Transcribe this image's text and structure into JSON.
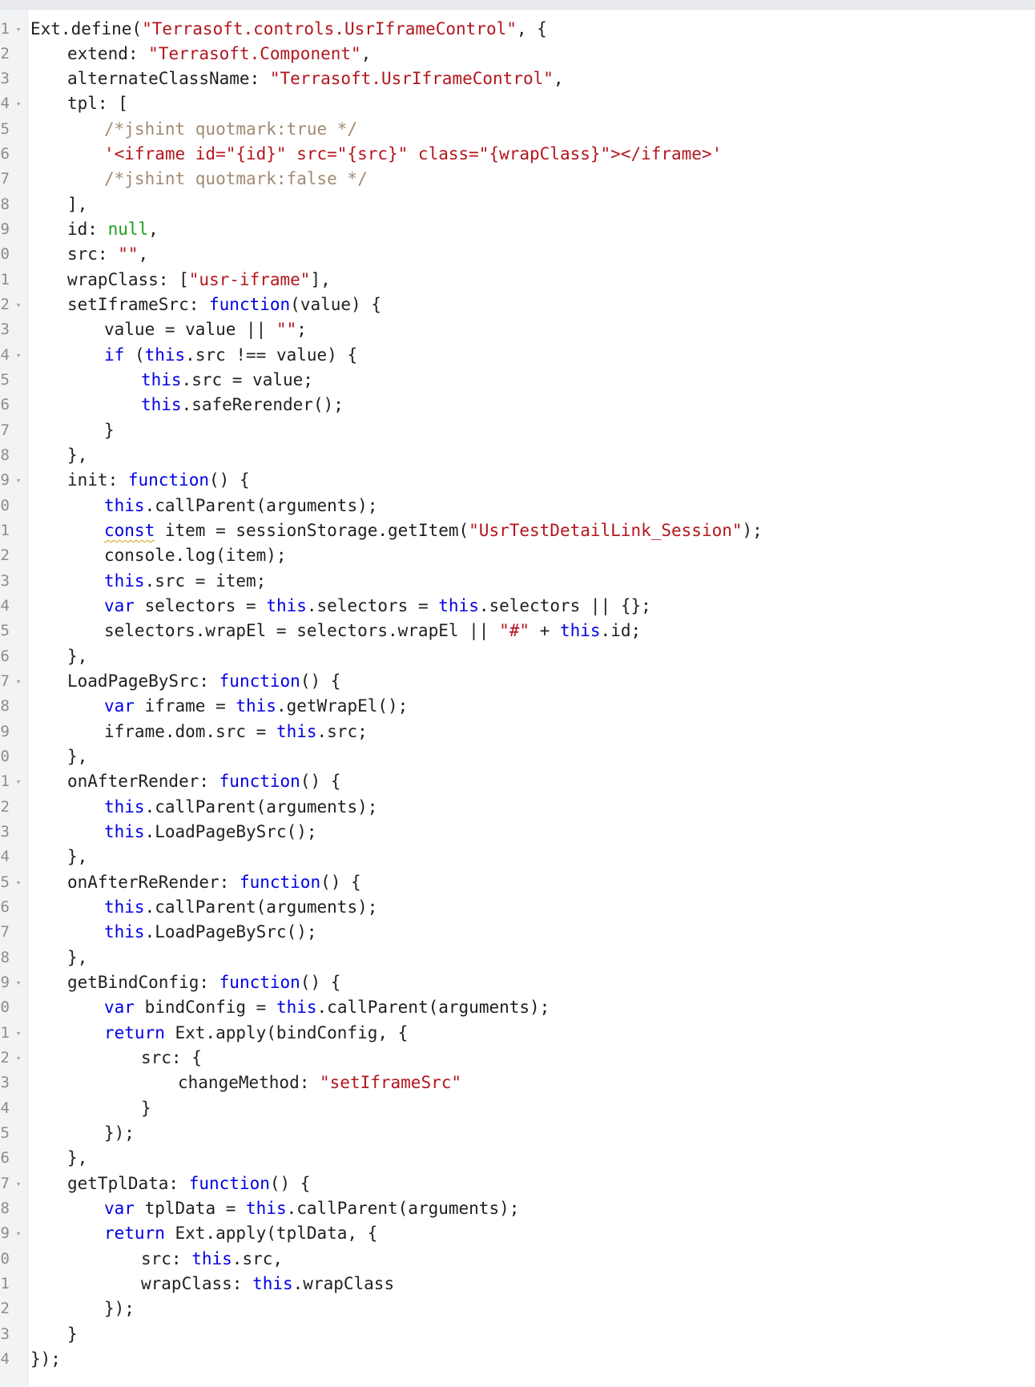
{
  "editor": {
    "lines": [
      {
        "n": "1",
        "fold": true,
        "ind": 0,
        "seg": [
          [
            "pl",
            "Ext.define("
          ],
          [
            "str",
            "\"Terrasoft.controls.UsrIframeControl\""
          ],
          [
            "pl",
            ", {"
          ]
        ]
      },
      {
        "n": "2",
        "fold": false,
        "ind": 1,
        "seg": [
          [
            "pl",
            "extend: "
          ],
          [
            "str",
            "\"Terrasoft.Component\""
          ],
          [
            "pl",
            ","
          ]
        ]
      },
      {
        "n": "3",
        "fold": false,
        "ind": 1,
        "seg": [
          [
            "pl",
            "alternateClassName: "
          ],
          [
            "str",
            "\"Terrasoft.UsrIframeControl\""
          ],
          [
            "pl",
            ","
          ]
        ]
      },
      {
        "n": "4",
        "fold": true,
        "ind": 1,
        "seg": [
          [
            "pl",
            "tpl: ["
          ]
        ]
      },
      {
        "n": "5",
        "fold": false,
        "ind": 2,
        "seg": [
          [
            "cmt",
            "/*jshint quotmark:true */"
          ]
        ]
      },
      {
        "n": "6",
        "fold": false,
        "ind": 2,
        "seg": [
          [
            "str",
            "'<iframe id=\"{id}\" src=\"{src}\" class=\"{wrapClass}\"></iframe>'"
          ]
        ]
      },
      {
        "n": "7",
        "fold": false,
        "ind": 2,
        "seg": [
          [
            "cmt",
            "/*jshint quotmark:false */"
          ]
        ]
      },
      {
        "n": "8",
        "fold": false,
        "ind": 1,
        "seg": [
          [
            "pl",
            "],"
          ]
        ]
      },
      {
        "n": "9",
        "fold": false,
        "ind": 1,
        "seg": [
          [
            "pl",
            "id: "
          ],
          [
            "num",
            "null"
          ],
          [
            "pl",
            ","
          ]
        ]
      },
      {
        "n": "0",
        "fold": false,
        "ind": 1,
        "seg": [
          [
            "pl",
            "src: "
          ],
          [
            "str",
            "\"\""
          ],
          [
            "pl",
            ","
          ]
        ]
      },
      {
        "n": "1",
        "fold": false,
        "ind": 1,
        "seg": [
          [
            "pl",
            "wrapClass: ["
          ],
          [
            "str",
            "\"usr-iframe\""
          ],
          [
            "pl",
            "],"
          ]
        ]
      },
      {
        "n": "2",
        "fold": true,
        "ind": 1,
        "seg": [
          [
            "pl",
            "setIframeSrc: "
          ],
          [
            "kw",
            "function"
          ],
          [
            "pl",
            "(value) {"
          ]
        ]
      },
      {
        "n": "3",
        "fold": false,
        "ind": 2,
        "seg": [
          [
            "pl",
            "value = value || "
          ],
          [
            "str",
            "\"\""
          ],
          [
            "pl",
            ";"
          ]
        ]
      },
      {
        "n": "4",
        "fold": true,
        "ind": 2,
        "seg": [
          [
            "kw",
            "if"
          ],
          [
            "pl",
            " ("
          ],
          [
            "kw",
            "this"
          ],
          [
            "pl",
            ".src !== value) {"
          ]
        ]
      },
      {
        "n": "5",
        "fold": false,
        "ind": 3,
        "seg": [
          [
            "kw",
            "this"
          ],
          [
            "pl",
            ".src = value;"
          ]
        ]
      },
      {
        "n": "6",
        "fold": false,
        "ind": 3,
        "seg": [
          [
            "kw",
            "this"
          ],
          [
            "pl",
            ".safeRerender();"
          ]
        ]
      },
      {
        "n": "7",
        "fold": false,
        "ind": 2,
        "seg": [
          [
            "pl",
            "}"
          ]
        ]
      },
      {
        "n": "8",
        "fold": false,
        "ind": 1,
        "seg": [
          [
            "pl",
            "},"
          ]
        ]
      },
      {
        "n": "9",
        "fold": true,
        "ind": 1,
        "seg": [
          [
            "pl",
            "init: "
          ],
          [
            "kw",
            "function"
          ],
          [
            "pl",
            "() {"
          ]
        ]
      },
      {
        "n": "0",
        "fold": false,
        "ind": 2,
        "seg": [
          [
            "kw",
            "this"
          ],
          [
            "pl",
            ".callParent(arguments);"
          ]
        ]
      },
      {
        "n": "1",
        "fold": false,
        "ind": 2,
        "seg": [
          [
            "kwsq",
            "const"
          ],
          [
            "pl",
            " item = sessionStorage.getItem("
          ],
          [
            "str",
            "\"UsrTestDetailLink_Session\""
          ],
          [
            "pl",
            ");"
          ]
        ]
      },
      {
        "n": "2",
        "fold": false,
        "ind": 2,
        "seg": [
          [
            "pl",
            "console.log(item);"
          ]
        ]
      },
      {
        "n": "3",
        "fold": false,
        "ind": 2,
        "seg": [
          [
            "kw",
            "this"
          ],
          [
            "pl",
            ".src = item;"
          ]
        ]
      },
      {
        "n": "4",
        "fold": false,
        "ind": 2,
        "seg": [
          [
            "kw",
            "var"
          ],
          [
            "pl",
            " selectors = "
          ],
          [
            "kw",
            "this"
          ],
          [
            "pl",
            ".selectors = "
          ],
          [
            "kw",
            "this"
          ],
          [
            "pl",
            ".selectors || {};"
          ]
        ]
      },
      {
        "n": "5",
        "fold": false,
        "ind": 2,
        "seg": [
          [
            "pl",
            "selectors.wrapEl = selectors.wrapEl || "
          ],
          [
            "str",
            "\"#\""
          ],
          [
            "pl",
            " + "
          ],
          [
            "kw",
            "this"
          ],
          [
            "pl",
            ".id;"
          ]
        ]
      },
      {
        "n": "6",
        "fold": false,
        "ind": 1,
        "seg": [
          [
            "pl",
            "},"
          ]
        ]
      },
      {
        "n": "7",
        "fold": true,
        "ind": 1,
        "seg": [
          [
            "pl",
            "LoadPageBySrc: "
          ],
          [
            "kw",
            "function"
          ],
          [
            "pl",
            "() {"
          ]
        ]
      },
      {
        "n": "8",
        "fold": false,
        "ind": 2,
        "seg": [
          [
            "kw",
            "var"
          ],
          [
            "pl",
            " iframe = "
          ],
          [
            "kw",
            "this"
          ],
          [
            "pl",
            ".getWrapEl();"
          ]
        ]
      },
      {
        "n": "9",
        "fold": false,
        "ind": 2,
        "seg": [
          [
            "pl",
            "iframe.dom.src = "
          ],
          [
            "kw",
            "this"
          ],
          [
            "pl",
            ".src;"
          ]
        ]
      },
      {
        "n": "0",
        "fold": false,
        "ind": 1,
        "seg": [
          [
            "pl",
            "},"
          ]
        ]
      },
      {
        "n": "1",
        "fold": true,
        "ind": 1,
        "seg": [
          [
            "pl",
            "onAfterRender: "
          ],
          [
            "kw",
            "function"
          ],
          [
            "pl",
            "() {"
          ]
        ]
      },
      {
        "n": "2",
        "fold": false,
        "ind": 2,
        "seg": [
          [
            "kw",
            "this"
          ],
          [
            "pl",
            ".callParent(arguments);"
          ]
        ]
      },
      {
        "n": "3",
        "fold": false,
        "ind": 2,
        "seg": [
          [
            "kw",
            "this"
          ],
          [
            "pl",
            ".LoadPageBySrc();"
          ]
        ]
      },
      {
        "n": "4",
        "fold": false,
        "ind": 1,
        "seg": [
          [
            "pl",
            "},"
          ]
        ]
      },
      {
        "n": "5",
        "fold": true,
        "ind": 1,
        "seg": [
          [
            "pl",
            "onAfterReRender: "
          ],
          [
            "kw",
            "function"
          ],
          [
            "pl",
            "() {"
          ]
        ]
      },
      {
        "n": "6",
        "fold": false,
        "ind": 2,
        "seg": [
          [
            "kw",
            "this"
          ],
          [
            "pl",
            ".callParent(arguments);"
          ]
        ]
      },
      {
        "n": "7",
        "fold": false,
        "ind": 2,
        "seg": [
          [
            "kw",
            "this"
          ],
          [
            "pl",
            ".LoadPageBySrc();"
          ]
        ]
      },
      {
        "n": "8",
        "fold": false,
        "ind": 1,
        "seg": [
          [
            "pl",
            "},"
          ]
        ]
      },
      {
        "n": "9",
        "fold": true,
        "ind": 1,
        "seg": [
          [
            "pl",
            "getBindConfig: "
          ],
          [
            "kw",
            "function"
          ],
          [
            "pl",
            "() {"
          ]
        ]
      },
      {
        "n": "0",
        "fold": false,
        "ind": 2,
        "seg": [
          [
            "kw",
            "var"
          ],
          [
            "pl",
            " bindConfig = "
          ],
          [
            "kw",
            "this"
          ],
          [
            "pl",
            ".callParent(arguments);"
          ]
        ]
      },
      {
        "n": "1",
        "fold": true,
        "ind": 2,
        "seg": [
          [
            "kw",
            "return"
          ],
          [
            "pl",
            " Ext.apply(bindConfig, {"
          ]
        ]
      },
      {
        "n": "2",
        "fold": true,
        "ind": 3,
        "seg": [
          [
            "pl",
            "src: {"
          ]
        ]
      },
      {
        "n": "3",
        "fold": false,
        "ind": 4,
        "seg": [
          [
            "pl",
            "changeMethod: "
          ],
          [
            "str",
            "\"setIframeSrc\""
          ]
        ]
      },
      {
        "n": "4",
        "fold": false,
        "ind": 3,
        "seg": [
          [
            "pl",
            "}"
          ]
        ]
      },
      {
        "n": "5",
        "fold": false,
        "ind": 2,
        "seg": [
          [
            "pl",
            "});"
          ]
        ]
      },
      {
        "n": "6",
        "fold": false,
        "ind": 1,
        "seg": [
          [
            "pl",
            "},"
          ]
        ]
      },
      {
        "n": "7",
        "fold": true,
        "ind": 1,
        "seg": [
          [
            "pl",
            "getTplData: "
          ],
          [
            "kw",
            "function"
          ],
          [
            "pl",
            "() {"
          ]
        ]
      },
      {
        "n": "8",
        "fold": false,
        "ind": 2,
        "seg": [
          [
            "kw",
            "var"
          ],
          [
            "pl",
            " tplData = "
          ],
          [
            "kw",
            "this"
          ],
          [
            "pl",
            ".callParent(arguments);"
          ]
        ]
      },
      {
        "n": "9",
        "fold": true,
        "ind": 2,
        "seg": [
          [
            "kw",
            "return"
          ],
          [
            "pl",
            " Ext.apply(tplData, {"
          ]
        ]
      },
      {
        "n": "0",
        "fold": false,
        "ind": 3,
        "seg": [
          [
            "pl",
            "src: "
          ],
          [
            "kw",
            "this"
          ],
          [
            "pl",
            ".src,"
          ]
        ]
      },
      {
        "n": "1",
        "fold": false,
        "ind": 3,
        "seg": [
          [
            "pl",
            "wrapClass: "
          ],
          [
            "kw",
            "this"
          ],
          [
            "pl",
            ".wrapClass"
          ]
        ]
      },
      {
        "n": "2",
        "fold": false,
        "ind": 2,
        "seg": [
          [
            "pl",
            "});"
          ]
        ]
      },
      {
        "n": "3",
        "fold": false,
        "ind": 1,
        "seg": [
          [
            "pl",
            "}"
          ]
        ]
      },
      {
        "n": "4",
        "fold": false,
        "ind": 0,
        "seg": [
          [
            "pl",
            "});"
          ]
        ]
      }
    ]
  }
}
